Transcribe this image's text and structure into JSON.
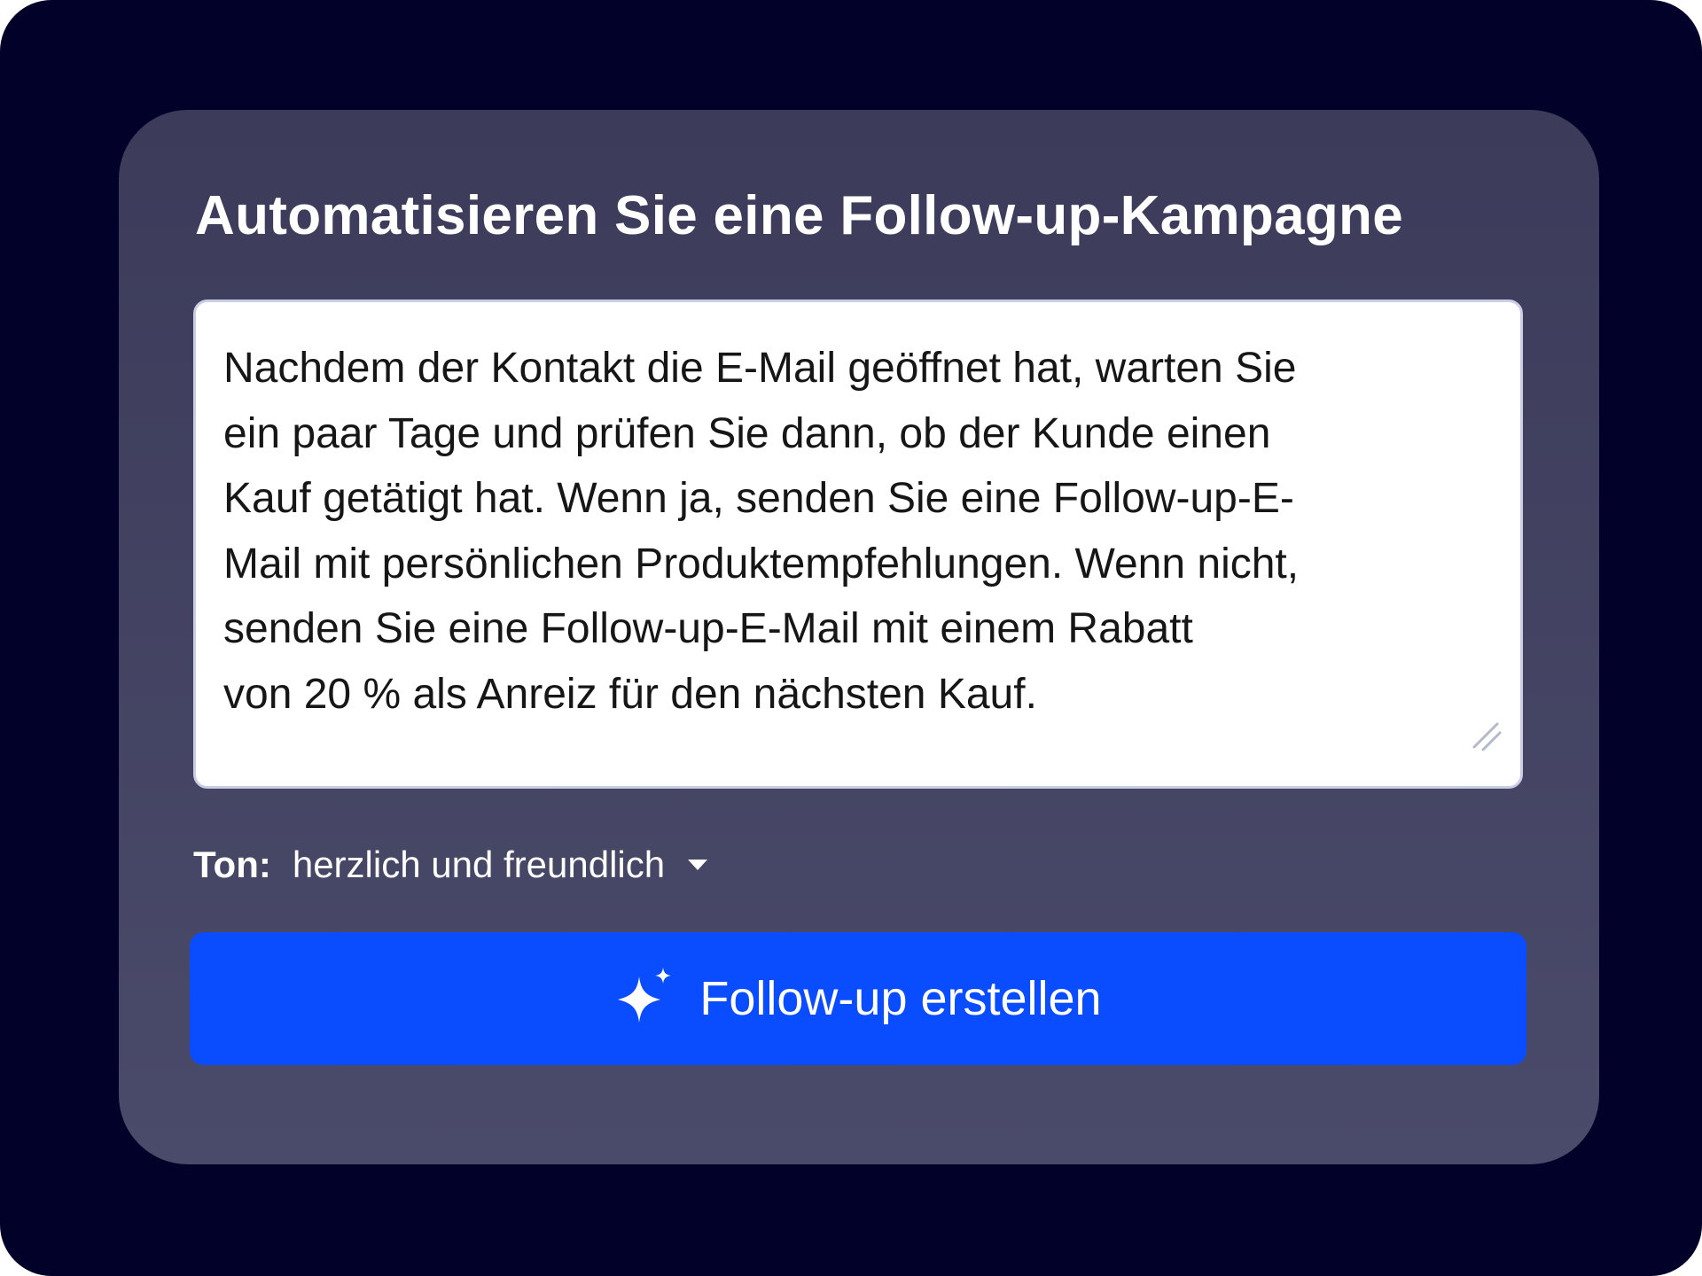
{
  "card": {
    "title": "Automatisieren Sie eine Follow-up-Kampagne",
    "colors": {
      "background": "#020129",
      "panel": "#42415f",
      "accent": "#0a4cff",
      "input_border": "#c9cde6"
    }
  },
  "prompt": {
    "value": "Nachdem der Kontakt die E-Mail geöffnet hat, warten Sie\nein paar Tage und prüfen Sie dann, ob der Kunde einen\nKauf getätigt hat. Wenn ja, senden Sie eine Follow-up-E-\nMail mit persönlichen Produktempfehlungen. Wenn nicht,\nsenden Sie eine Follow-up-E-Mail mit einem Rabatt\nvon 20 % als Anreiz für den nächsten Kauf.",
    "resize_icon": "resize-handle-icon"
  },
  "tone": {
    "label": "Ton:",
    "selected": "herzlich und freundlich",
    "dropdown_icon": "caret-down-icon"
  },
  "generate_button": {
    "label": "Follow-up erstellen",
    "icon": "sparkle-icon"
  }
}
